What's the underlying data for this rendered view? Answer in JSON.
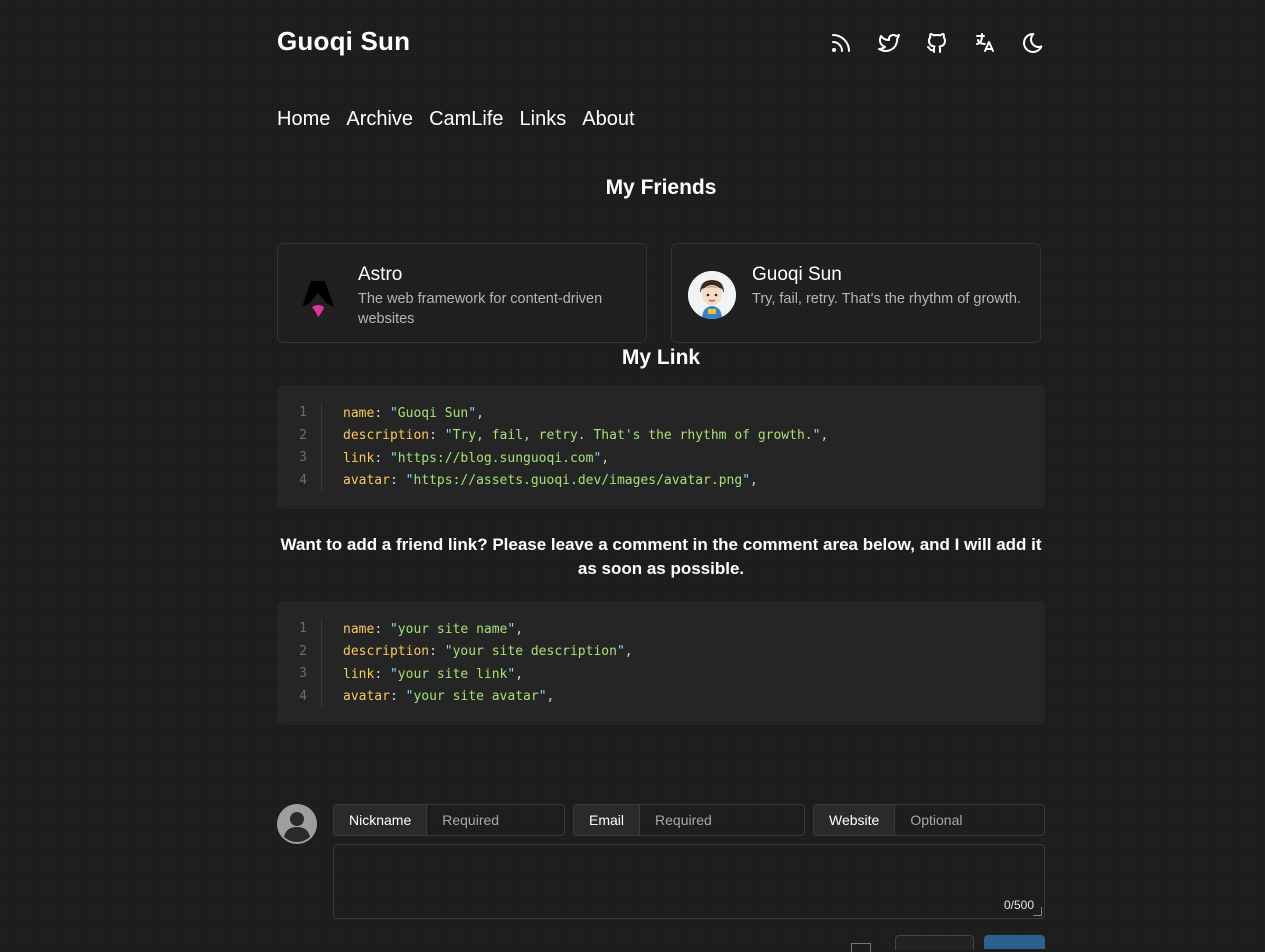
{
  "header": {
    "title": "Guoqi Sun",
    "icons": [
      "rss-icon",
      "twitter-icon",
      "github-icon",
      "translate-icon",
      "moon-icon"
    ]
  },
  "nav": {
    "items": [
      "Home",
      "Archive",
      "CamLife",
      "Links",
      "About"
    ]
  },
  "friends": {
    "heading": "My Friends",
    "cards": [
      {
        "name": "Astro",
        "description": "The web framework for content-driven websites"
      },
      {
        "name": "Guoqi Sun",
        "description": "Try, fail, retry. That's the rhythm of growth."
      }
    ]
  },
  "my_link": {
    "heading": "My Link",
    "lines": [
      {
        "num": "1",
        "key": "name",
        "value": "Guoqi Sun"
      },
      {
        "num": "2",
        "key": "description",
        "value": "Try, fail, retry. That's the rhythm of growth."
      },
      {
        "num": "3",
        "key": "link",
        "value": "https://blog.sunguoqi.com"
      },
      {
        "num": "4",
        "key": "avatar",
        "value": "https://assets.guoqi.dev/images/avatar.png"
      }
    ]
  },
  "note": "Want to add a friend link? Please leave a comment in the comment area below, and I will add it as soon as possible.",
  "template": {
    "lines": [
      {
        "num": "1",
        "key": "name",
        "value": "your site name"
      },
      {
        "num": "2",
        "key": "description",
        "value": "your site description"
      },
      {
        "num": "3",
        "key": "link",
        "value": "your site link"
      },
      {
        "num": "4",
        "key": "avatar",
        "value": "your site avatar"
      }
    ]
  },
  "comment": {
    "nickname_label": "Nickname",
    "nickname_placeholder": "Required",
    "email_label": "Email",
    "email_placeholder": "Required",
    "website_label": "Website",
    "website_placeholder": "Optional",
    "counter": "0/500"
  },
  "colors": {
    "background": "#1c1c1c",
    "code_bg": "#252526",
    "code_key": "#f9c859",
    "code_string": "#a5e075",
    "submit": "#2d5f8f"
  }
}
